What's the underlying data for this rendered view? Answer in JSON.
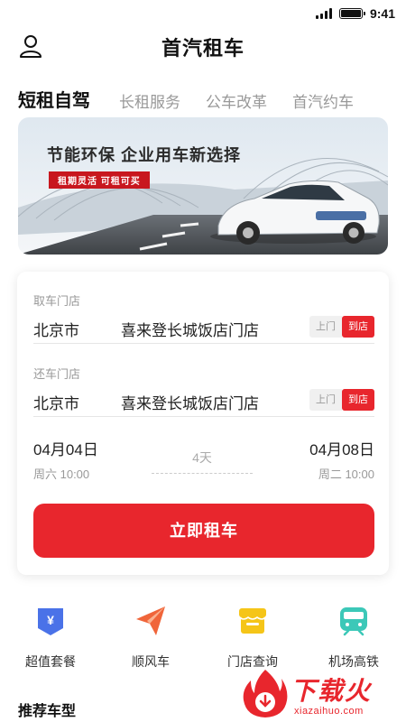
{
  "status_bar": {
    "time": "9:41"
  },
  "header": {
    "title": "首汽租车",
    "user_icon": "user-icon"
  },
  "tabs": [
    {
      "label": "短租自驾",
      "active": true
    },
    {
      "label": "长租服务",
      "active": false
    },
    {
      "label": "公车改革",
      "active": false
    },
    {
      "label": "首汽约车",
      "active": false
    }
  ],
  "banner": {
    "title": "节能环保  企业用车新选择",
    "subtitle": "租期灵活  可租可买"
  },
  "booking": {
    "pickup": {
      "label": "取车门店",
      "city": "北京市",
      "store": "喜来登长城饭店门店",
      "toggle_off": "上门",
      "toggle_on": "到店"
    },
    "return": {
      "label": "还车门店",
      "city": "北京市",
      "store": "喜来登长城饭店门店",
      "toggle_off": "上门",
      "toggle_on": "到店"
    },
    "start_date": "04月04日",
    "start_day": "周六 10:00",
    "end_date": "04月08日",
    "end_day": "周二 10:00",
    "duration": "4天",
    "button": "立即租车"
  },
  "quick_links": [
    {
      "label": "超值套餐",
      "icon": "yen-shield-icon"
    },
    {
      "label": "顺风车",
      "icon": "paper-plane-icon"
    },
    {
      "label": "门店查询",
      "icon": "storefront-icon"
    },
    {
      "label": "机场高铁",
      "icon": "train-icon"
    }
  ],
  "section": {
    "title": "推荐车型"
  },
  "watermark": {
    "text": "下载火",
    "url": "xiazaihuo.com"
  },
  "colors": {
    "accent": "#e8262d",
    "yellow": "#f5c518",
    "blue": "#4a72e8",
    "orange": "#f0653a",
    "teal": "#3cc8b8"
  }
}
